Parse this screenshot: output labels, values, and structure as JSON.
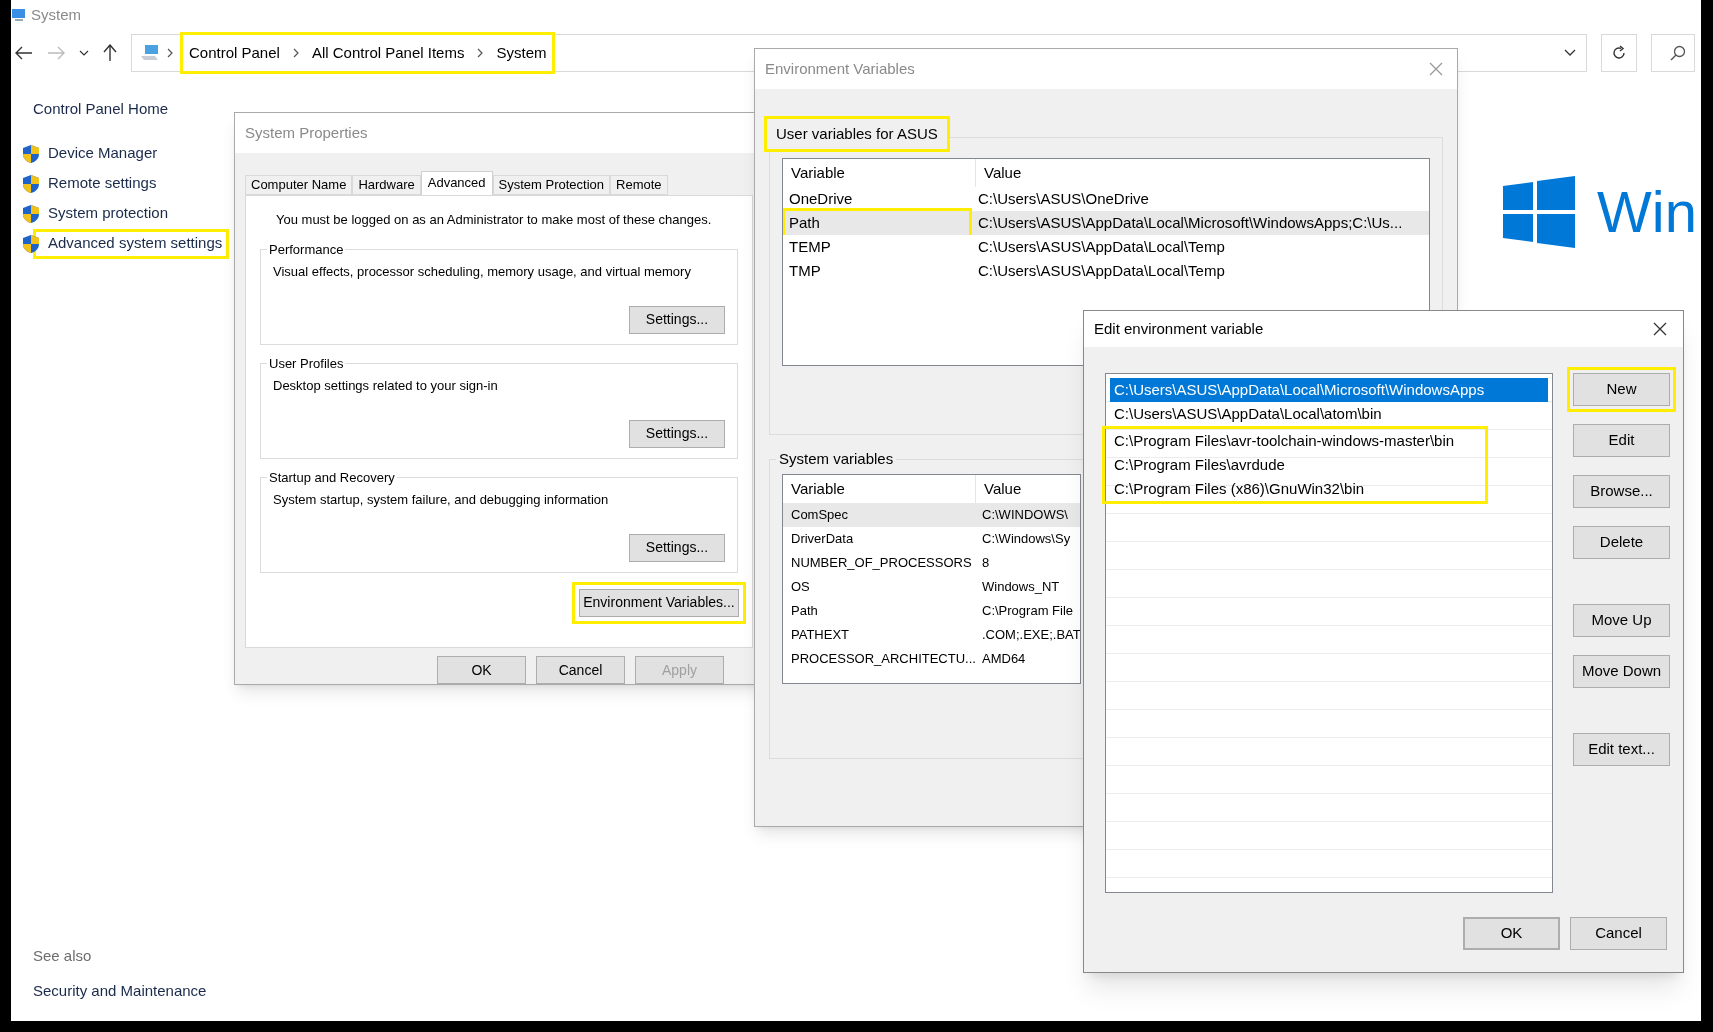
{
  "explorer": {
    "title": "System",
    "breadcrumb": {
      "items": [
        "Control Panel",
        "All Control Panel Items",
        "System"
      ],
      "highlighted": true
    },
    "nav": {
      "home": "Control Panel Home",
      "items": [
        {
          "label": "Device Manager",
          "highlighted": false
        },
        {
          "label": "Remote settings",
          "highlighted": false
        },
        {
          "label": "System protection",
          "highlighted": false
        },
        {
          "label": "Advanced system settings",
          "highlighted": true
        }
      ]
    },
    "see_also": {
      "heading": "See also",
      "links": [
        "Security and Maintenance"
      ]
    },
    "brand_text": "Win"
  },
  "system_properties": {
    "title": "System Properties",
    "tabs": [
      {
        "label": "Computer Name",
        "selected": false
      },
      {
        "label": "Hardware",
        "selected": false
      },
      {
        "label": "Advanced",
        "selected": true
      },
      {
        "label": "System Protection",
        "selected": false
      },
      {
        "label": "Remote",
        "selected": false
      }
    ],
    "notice": "You must be logged on as an Administrator to make most of these changes.",
    "groups": [
      {
        "title": "Performance",
        "description": "Visual effects, processor scheduling, memory usage, and virtual memory",
        "button": "Settings..."
      },
      {
        "title": "User Profiles",
        "description": "Desktop settings related to your sign-in",
        "button": "Settings..."
      },
      {
        "title": "Startup and Recovery",
        "description": "System startup, system failure, and debugging information",
        "button": "Settings..."
      }
    ],
    "env_button": {
      "label": "Environment Variables...",
      "highlighted": true
    },
    "buttons": [
      {
        "label": "OK",
        "disabled": false
      },
      {
        "label": "Cancel",
        "disabled": false
      },
      {
        "label": "Apply",
        "disabled": true
      }
    ]
  },
  "environment_variables": {
    "title": "Environment Variables",
    "user_group": {
      "title": "User variables for ASUS",
      "highlighted": true
    },
    "user_table": {
      "columns": [
        "Variable",
        "Value"
      ],
      "rows": [
        {
          "variable": "OneDrive",
          "value": "C:\\Users\\ASUS\\OneDrive",
          "selected": false,
          "highlighted": false
        },
        {
          "variable": "Path",
          "value": "C:\\Users\\ASUS\\AppData\\Local\\Microsoft\\WindowsApps;C:\\Us...",
          "selected": true,
          "highlighted": true
        },
        {
          "variable": "TEMP",
          "value": "C:\\Users\\ASUS\\AppData\\Local\\Temp",
          "selected": false,
          "highlighted": false
        },
        {
          "variable": "TMP",
          "value": "C:\\Users\\ASUS\\AppData\\Local\\Temp",
          "selected": false,
          "highlighted": false
        }
      ]
    },
    "system_group": {
      "title": "System variables"
    },
    "system_table": {
      "columns": [
        "Variable",
        "Value"
      ],
      "rows": [
        {
          "variable": "ComSpec",
          "value": "C:\\WINDOWS\\",
          "selected": true
        },
        {
          "variable": "DriverData",
          "value": "C:\\Windows\\Sy",
          "selected": false
        },
        {
          "variable": "NUMBER_OF_PROCESSORS",
          "value": "8",
          "selected": false
        },
        {
          "variable": "OS",
          "value": "Windows_NT",
          "selected": false
        },
        {
          "variable": "Path",
          "value": "C:\\Program File",
          "selected": false
        },
        {
          "variable": "PATHEXT",
          "value": ".COM;.EXE;.BAT",
          "selected": false
        },
        {
          "variable": "PROCESSOR_ARCHITECTU...",
          "value": "AMD64",
          "selected": false
        }
      ]
    }
  },
  "edit_dialog": {
    "title": "Edit environment variable",
    "entries": [
      {
        "text": "C:\\Users\\ASUS\\AppData\\Local\\Microsoft\\WindowsApps",
        "selected": true,
        "highlighted": false
      },
      {
        "text": "C:\\Users\\ASUS\\AppData\\Local\\atom\\bin",
        "selected": false,
        "highlighted": false
      },
      {
        "text": "C:\\Program Files\\avr-toolchain-windows-master\\bin",
        "selected": false,
        "highlighted": true
      },
      {
        "text": "C:\\Program Files\\avrdude",
        "selected": false,
        "highlighted": true
      },
      {
        "text": "C:\\Program Files (x86)\\GnuWin32\\bin",
        "selected": false,
        "highlighted": true
      }
    ],
    "side_button_groups": [
      [
        {
          "label": "New",
          "highlighted": true
        },
        {
          "label": "Edit",
          "highlighted": false
        },
        {
          "label": "Browse...",
          "highlighted": false
        },
        {
          "label": "Delete",
          "highlighted": false
        }
      ],
      [
        {
          "label": "Move Up",
          "highlighted": false
        },
        {
          "label": "Move Down",
          "highlighted": false
        }
      ],
      [
        {
          "label": "Edit text...",
          "highlighted": false
        }
      ]
    ],
    "buttons": [
      {
        "label": "OK",
        "default": true
      },
      {
        "label": "Cancel",
        "default": false
      }
    ]
  }
}
